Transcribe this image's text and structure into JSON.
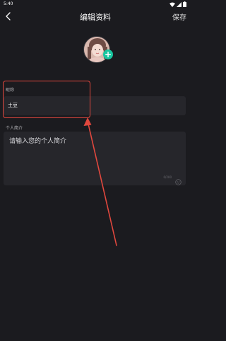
{
  "status_bar": {
    "time": "5:40",
    "icons": [
      "wifi-icon",
      "signal-icon",
      "battery-icon"
    ]
  },
  "header": {
    "title": "编辑资料",
    "save_label": "保存",
    "back_icon": "chevron-left-icon"
  },
  "avatar": {
    "add_icon_label": "+",
    "add_icon_color": "#19c6a0"
  },
  "nickname": {
    "label": "昵称",
    "value": "土豆"
  },
  "bio": {
    "label": "个人简介",
    "placeholder": "请输入您的个人简介",
    "counter": "0/200",
    "emoji_icon": "emoji-icon"
  },
  "colors": {
    "background": "#1b1b1f",
    "field_background": "#26262b",
    "annotation": "#e2483e",
    "accent": "#19c6a0"
  }
}
